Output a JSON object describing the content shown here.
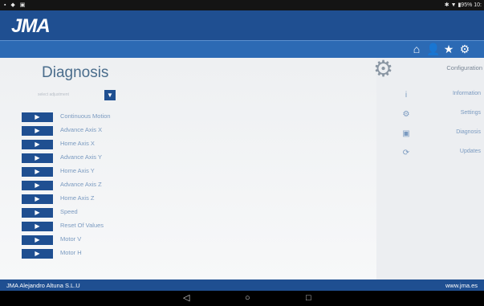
{
  "status": {
    "left_icons": "▪ ◆ ▣",
    "right": "✱ ▼ ▮95% 10:"
  },
  "header": {
    "logo": "JMA"
  },
  "toolbar": {
    "icons": [
      "home-icon",
      "user-icon",
      "star-icon",
      "gear-icon"
    ]
  },
  "main": {
    "title": "Diagnosis",
    "select": {
      "placeholder": "select adjustment",
      "button": "▼"
    },
    "rows": [
      "Continuous Motion",
      "Advance Axis X",
      "Home Axis X",
      "Advance Axis Y",
      "Home Axis Y",
      "Advance Axis Z",
      "Home Axis Z",
      "Speed",
      "Reset Of Values",
      "Motor V",
      "Motor H"
    ],
    "run_icon": "▶"
  },
  "sidebar": {
    "title": "Configuration",
    "items": [
      {
        "label": "Information",
        "icon": "info-icon",
        "glyph": "i"
      },
      {
        "label": "Settings",
        "icon": "gear-icon",
        "glyph": "⚙"
      },
      {
        "label": "Diagnosis",
        "icon": "diagnosis-icon",
        "glyph": "▣"
      },
      {
        "label": "Updates",
        "icon": "refresh-icon",
        "glyph": "⟳"
      }
    ]
  },
  "footer": {
    "left": "JMA Alejandro Altuna S.L.U",
    "right": "www.jma.es"
  },
  "navbar": {
    "back": "◁",
    "home": "○",
    "recent": "□"
  },
  "colors": {
    "brand": "#1f4f91",
    "accent": "#2c6ab4",
    "link": "#7a9ac0"
  }
}
